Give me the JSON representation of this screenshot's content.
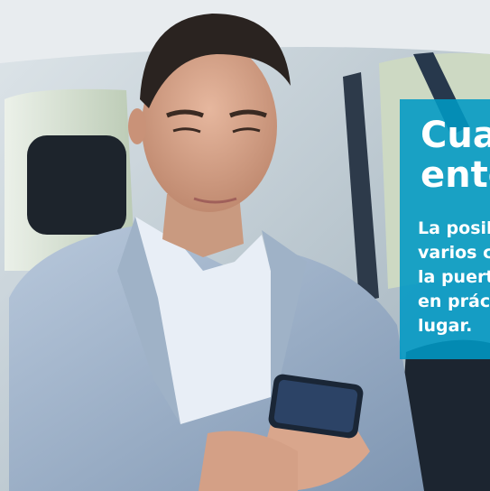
{
  "scene": {
    "description_icon": "man-using-smartphone-in-car-photo"
  },
  "promo": {
    "title": "Cua\nento",
    "body": "La posil\nvarios c\nla puert\nen práci\nlugar."
  },
  "colors": {
    "panel": "#0098c4",
    "text": "#ffffff"
  }
}
